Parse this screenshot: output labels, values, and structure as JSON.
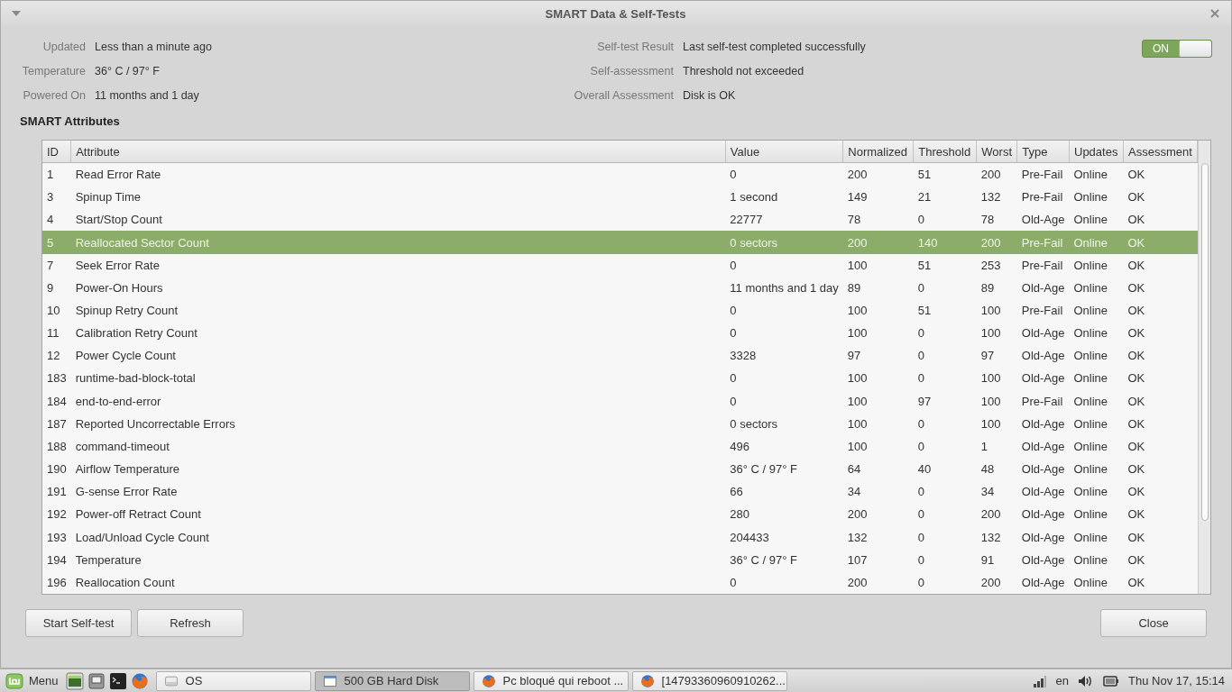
{
  "window": {
    "title": "SMART Data & Self-Tests"
  },
  "summary_left": [
    {
      "label": "Updated",
      "value": "Less than a minute ago"
    },
    {
      "label": "Temperature",
      "value": "36° C / 97° F"
    },
    {
      "label": "Powered On",
      "value": "11 months and 1 day"
    }
  ],
  "summary_right": [
    {
      "label": "Self-test Result",
      "value": "Last self-test completed successfully"
    },
    {
      "label": "Self-assessment",
      "value": "Threshold not exceeded"
    },
    {
      "label": "Overall Assessment",
      "value": "Disk is OK"
    }
  ],
  "smart_toggle": {
    "label": "ON",
    "on": true
  },
  "section_title": "SMART Attributes",
  "table": {
    "columns": [
      "ID",
      "Attribute",
      "Value",
      "Normalized",
      "Threshold",
      "Worst",
      "Type",
      "Updates",
      "Assessment"
    ],
    "rows": [
      {
        "cells": [
          "1",
          "Read Error Rate",
          "0",
          "200",
          "51",
          "200",
          "Pre-Fail",
          "Online",
          "OK"
        ],
        "selected": false
      },
      {
        "cells": [
          "3",
          "Spinup Time",
          "1 second",
          "149",
          "21",
          "132",
          "Pre-Fail",
          "Online",
          "OK"
        ],
        "selected": false
      },
      {
        "cells": [
          "4",
          "Start/Stop Count",
          "22777",
          "78",
          "0",
          "78",
          "Old-Age",
          "Online",
          "OK"
        ],
        "selected": false
      },
      {
        "cells": [
          "5",
          "Reallocated Sector Count",
          "0 sectors",
          "200",
          "140",
          "200",
          "Pre-Fail",
          "Online",
          "OK"
        ],
        "selected": true
      },
      {
        "cells": [
          "7",
          "Seek Error Rate",
          "0",
          "100",
          "51",
          "253",
          "Pre-Fail",
          "Online",
          "OK"
        ],
        "selected": false
      },
      {
        "cells": [
          "9",
          "Power-On Hours",
          "11 months and 1 day",
          "89",
          "0",
          "89",
          "Old-Age",
          "Online",
          "OK"
        ],
        "selected": false
      },
      {
        "cells": [
          "10",
          "Spinup Retry Count",
          "0",
          "100",
          "51",
          "100",
          "Pre-Fail",
          "Online",
          "OK"
        ],
        "selected": false
      },
      {
        "cells": [
          "11",
          "Calibration Retry Count",
          "0",
          "100",
          "0",
          "100",
          "Old-Age",
          "Online",
          "OK"
        ],
        "selected": false
      },
      {
        "cells": [
          "12",
          "Power Cycle Count",
          "3328",
          "97",
          "0",
          "97",
          "Old-Age",
          "Online",
          "OK"
        ],
        "selected": false
      },
      {
        "cells": [
          "183",
          "runtime-bad-block-total",
          "0",
          "100",
          "0",
          "100",
          "Old-Age",
          "Online",
          "OK"
        ],
        "selected": false
      },
      {
        "cells": [
          "184",
          "end-to-end-error",
          "0",
          "100",
          "97",
          "100",
          "Pre-Fail",
          "Online",
          "OK"
        ],
        "selected": false
      },
      {
        "cells": [
          "187",
          "Reported Uncorrectable Errors",
          "0 sectors",
          "100",
          "0",
          "100",
          "Old-Age",
          "Online",
          "OK"
        ],
        "selected": false
      },
      {
        "cells": [
          "188",
          "command-timeout",
          "496",
          "100",
          "0",
          "1",
          "Old-Age",
          "Online",
          "OK"
        ],
        "selected": false
      },
      {
        "cells": [
          "190",
          "Airflow Temperature",
          "36° C / 97° F",
          "64",
          "40",
          "48",
          "Old-Age",
          "Online",
          "OK"
        ],
        "selected": false
      },
      {
        "cells": [
          "191",
          "G-sense Error Rate",
          "66",
          "34",
          "0",
          "34",
          "Old-Age",
          "Online",
          "OK"
        ],
        "selected": false
      },
      {
        "cells": [
          "192",
          "Power-off Retract Count",
          "280",
          "200",
          "0",
          "200",
          "Old-Age",
          "Online",
          "OK"
        ],
        "selected": false
      },
      {
        "cells": [
          "193",
          "Load/Unload Cycle Count",
          "204433",
          "132",
          "0",
          "132",
          "Old-Age",
          "Online",
          "OK"
        ],
        "selected": false
      },
      {
        "cells": [
          "194",
          "Temperature",
          "36° C / 97° F",
          "107",
          "0",
          "91",
          "Old-Age",
          "Online",
          "OK"
        ],
        "selected": false
      },
      {
        "cells": [
          "196",
          "Reallocation Count",
          "0",
          "200",
          "0",
          "200",
          "Old-Age",
          "Online",
          "OK"
        ],
        "selected": false
      }
    ]
  },
  "buttons_left": [
    "Start Self-test",
    "Refresh"
  ],
  "buttons_right": [
    "Close"
  ],
  "taskbar": {
    "menu_label": "Menu",
    "launchers": [
      {
        "kind": "desktop"
      },
      {
        "kind": "computer"
      },
      {
        "kind": "terminal"
      },
      {
        "kind": "browser"
      }
    ],
    "windows": [
      {
        "label": "OS",
        "kind": "drive",
        "selected": false
      },
      {
        "label": "500 GB Hard Disk",
        "kind": "window",
        "selected": true
      },
      {
        "label": "Pc bloqué qui reboot ...",
        "kind": "browser",
        "selected": false
      },
      {
        "label": "[14793360960910262...",
        "kind": "browser",
        "selected": false
      }
    ],
    "keyboard_layout": "en",
    "clock": "Thu Nov 17, 15:14"
  }
}
